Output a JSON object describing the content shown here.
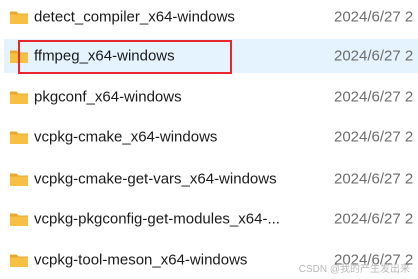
{
  "files": [
    {
      "name": "detect_compiler_x64-windows",
      "date": "2024/6/27 2"
    },
    {
      "name": "ffmpeg_x64-windows",
      "date": "2024/6/27 2"
    },
    {
      "name": "pkgconf_x64-windows",
      "date": "2024/6/27 2"
    },
    {
      "name": "vcpkg-cmake_x64-windows",
      "date": "2024/6/27 2"
    },
    {
      "name": "vcpkg-cmake-get-vars_x64-windows",
      "date": "2024/6/27 2"
    },
    {
      "name": "vcpkg-pkgconfig-get-modules_x64-...",
      "date": "2024/6/27 2"
    },
    {
      "name": "vcpkg-tool-meson_x64-windows",
      "date": "2024/6/27 2"
    }
  ],
  "watermark": "CSDN @我的产生发出来",
  "colors": {
    "selection": "#e5f3ff",
    "highlight_border": "#e8262d",
    "folder": "#f6c143"
  }
}
